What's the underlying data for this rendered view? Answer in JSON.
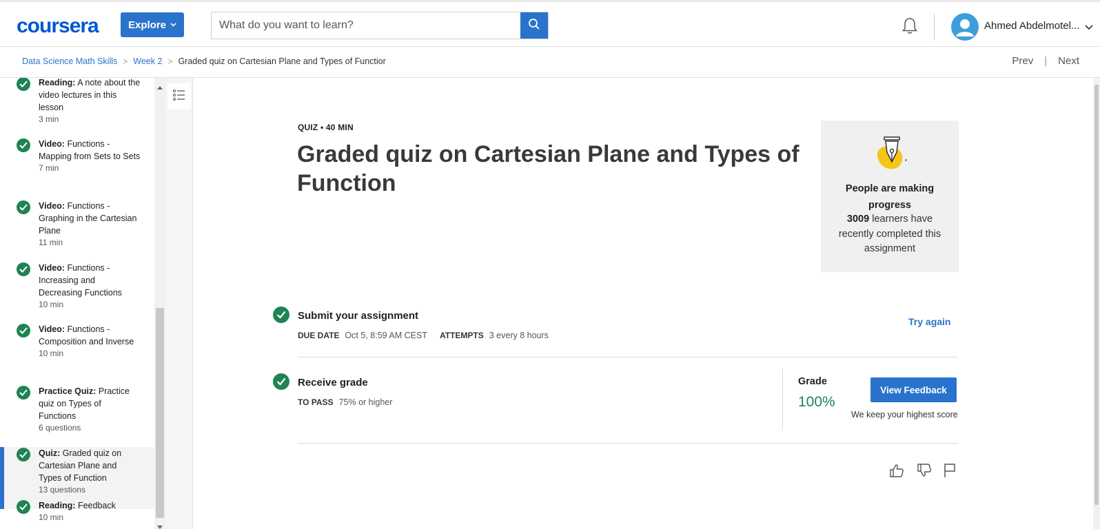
{
  "header": {
    "logo_text": "coursera",
    "explore_label": "Explore",
    "search_placeholder": "What do you want to learn?",
    "user_name": "Ahmed Abdelmotel..."
  },
  "breadcrumb": {
    "items": [
      "Data Science Math Skills",
      "Week 2"
    ],
    "current": "Graded quiz on Cartesian Plane and Types of Functior",
    "prev_label": "Prev",
    "next_label": "Next"
  },
  "sidebar": {
    "items": [
      {
        "type": "Reading:",
        "title": "A note about the video lectures in this lesson",
        "meta": "3 min"
      },
      {
        "type": "Video:",
        "title": "Functions - Mapping from Sets to Sets",
        "meta": "7 min"
      },
      {
        "type": "Video:",
        "title": "Functions - Graphing in the Cartesian Plane",
        "meta": "11 min"
      },
      {
        "type": "Video:",
        "title": "Functions - Increasing and Decreasing Functions",
        "meta": "10 min"
      },
      {
        "type": "Video:",
        "title": "Functions - Composition and Inverse",
        "meta": "10 min"
      },
      {
        "type": "Practice Quiz:",
        "title": "Practice quiz on Types of Functions",
        "meta": "6 questions"
      },
      {
        "type": "Quiz:",
        "title": "Graded quiz on Cartesian Plane and Types of Function",
        "meta": "13 questions",
        "active": true
      },
      {
        "type": "Reading:",
        "title": "Feedback",
        "meta": "10 min"
      }
    ]
  },
  "main": {
    "quiz_meta": "QUIZ • 40 MIN",
    "title": "Graded quiz on Cartesian Plane and Types of Function",
    "progress_card": {
      "headline": "People are making progress",
      "count": "3009",
      "body_rest": " learners have recently completed this assignment"
    },
    "submit": {
      "title": "Submit your assignment",
      "due_label": "DUE DATE",
      "due_value": "Oct 5, 8:59 AM CEST",
      "attempts_label": "ATTEMPTS",
      "attempts_value": "3 every 8 hours",
      "try_again": "Try again"
    },
    "receive": {
      "title": "Receive grade",
      "pass_label": "TO PASS",
      "pass_value": "75% or higher",
      "grade_label": "Grade",
      "grade_value": "100%",
      "view_feedback": "View Feedback",
      "keep_note": "We keep your highest score"
    }
  },
  "colors": {
    "brand_blue": "#2a73cc",
    "success_green": "#1f8354"
  }
}
